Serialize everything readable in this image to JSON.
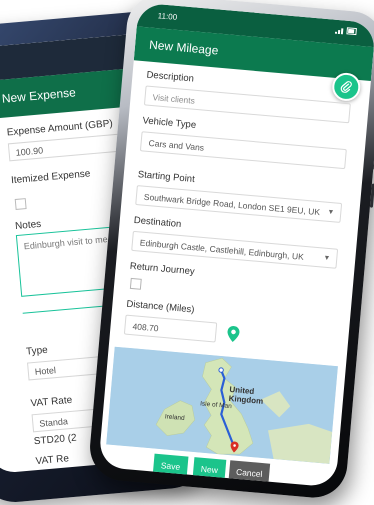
{
  "expense": {
    "title": "New Expense",
    "amount_label": "Expense Amount (GBP)",
    "amount_value": "100.90",
    "itemized_label": "Itemized Expense",
    "notes_label": "Notes",
    "notes_value": "Edinburgh visit to me",
    "type_label": "Type",
    "type_value": "Hotel",
    "vat_rate_label": "VAT Rate",
    "vat_rate_value": "Standa",
    "vat_code_value": "STD20 (2",
    "vat_rec_label": "VAT Re"
  },
  "mileage": {
    "status_time": "11:00",
    "title": "New Mileage",
    "description_label": "Description",
    "description_placeholder": "Visit clients",
    "vehicle_label": "Vehicle Type",
    "vehicle_value": "Cars and Vans",
    "start_label": "Starting Point",
    "start_value": "Southwark Bridge Road, London SE1 9EU, UK",
    "destination_label": "Destination",
    "destination_value": "Edinburgh Castle, Castlehill, Edinburgh, UK",
    "return_label": "Return Journey",
    "distance_label": "Distance (Miles)",
    "distance_value": "408.70",
    "map_labels": {
      "kingdom": "United Kingdom",
      "ireland": "Ireland",
      "isle_of_man": "Isle of Man"
    },
    "buttons": {
      "save": "Save",
      "new": "New",
      "cancel": "Cancel"
    }
  },
  "colors": {
    "header": "#0c7a4f",
    "accent": "#1bc48b",
    "cancel": "#5d5d5d"
  },
  "icons": [
    "paperclip-icon",
    "map-pin-icon",
    "dropdown-caret-icon",
    "signal-icon",
    "battery-icon"
  ]
}
